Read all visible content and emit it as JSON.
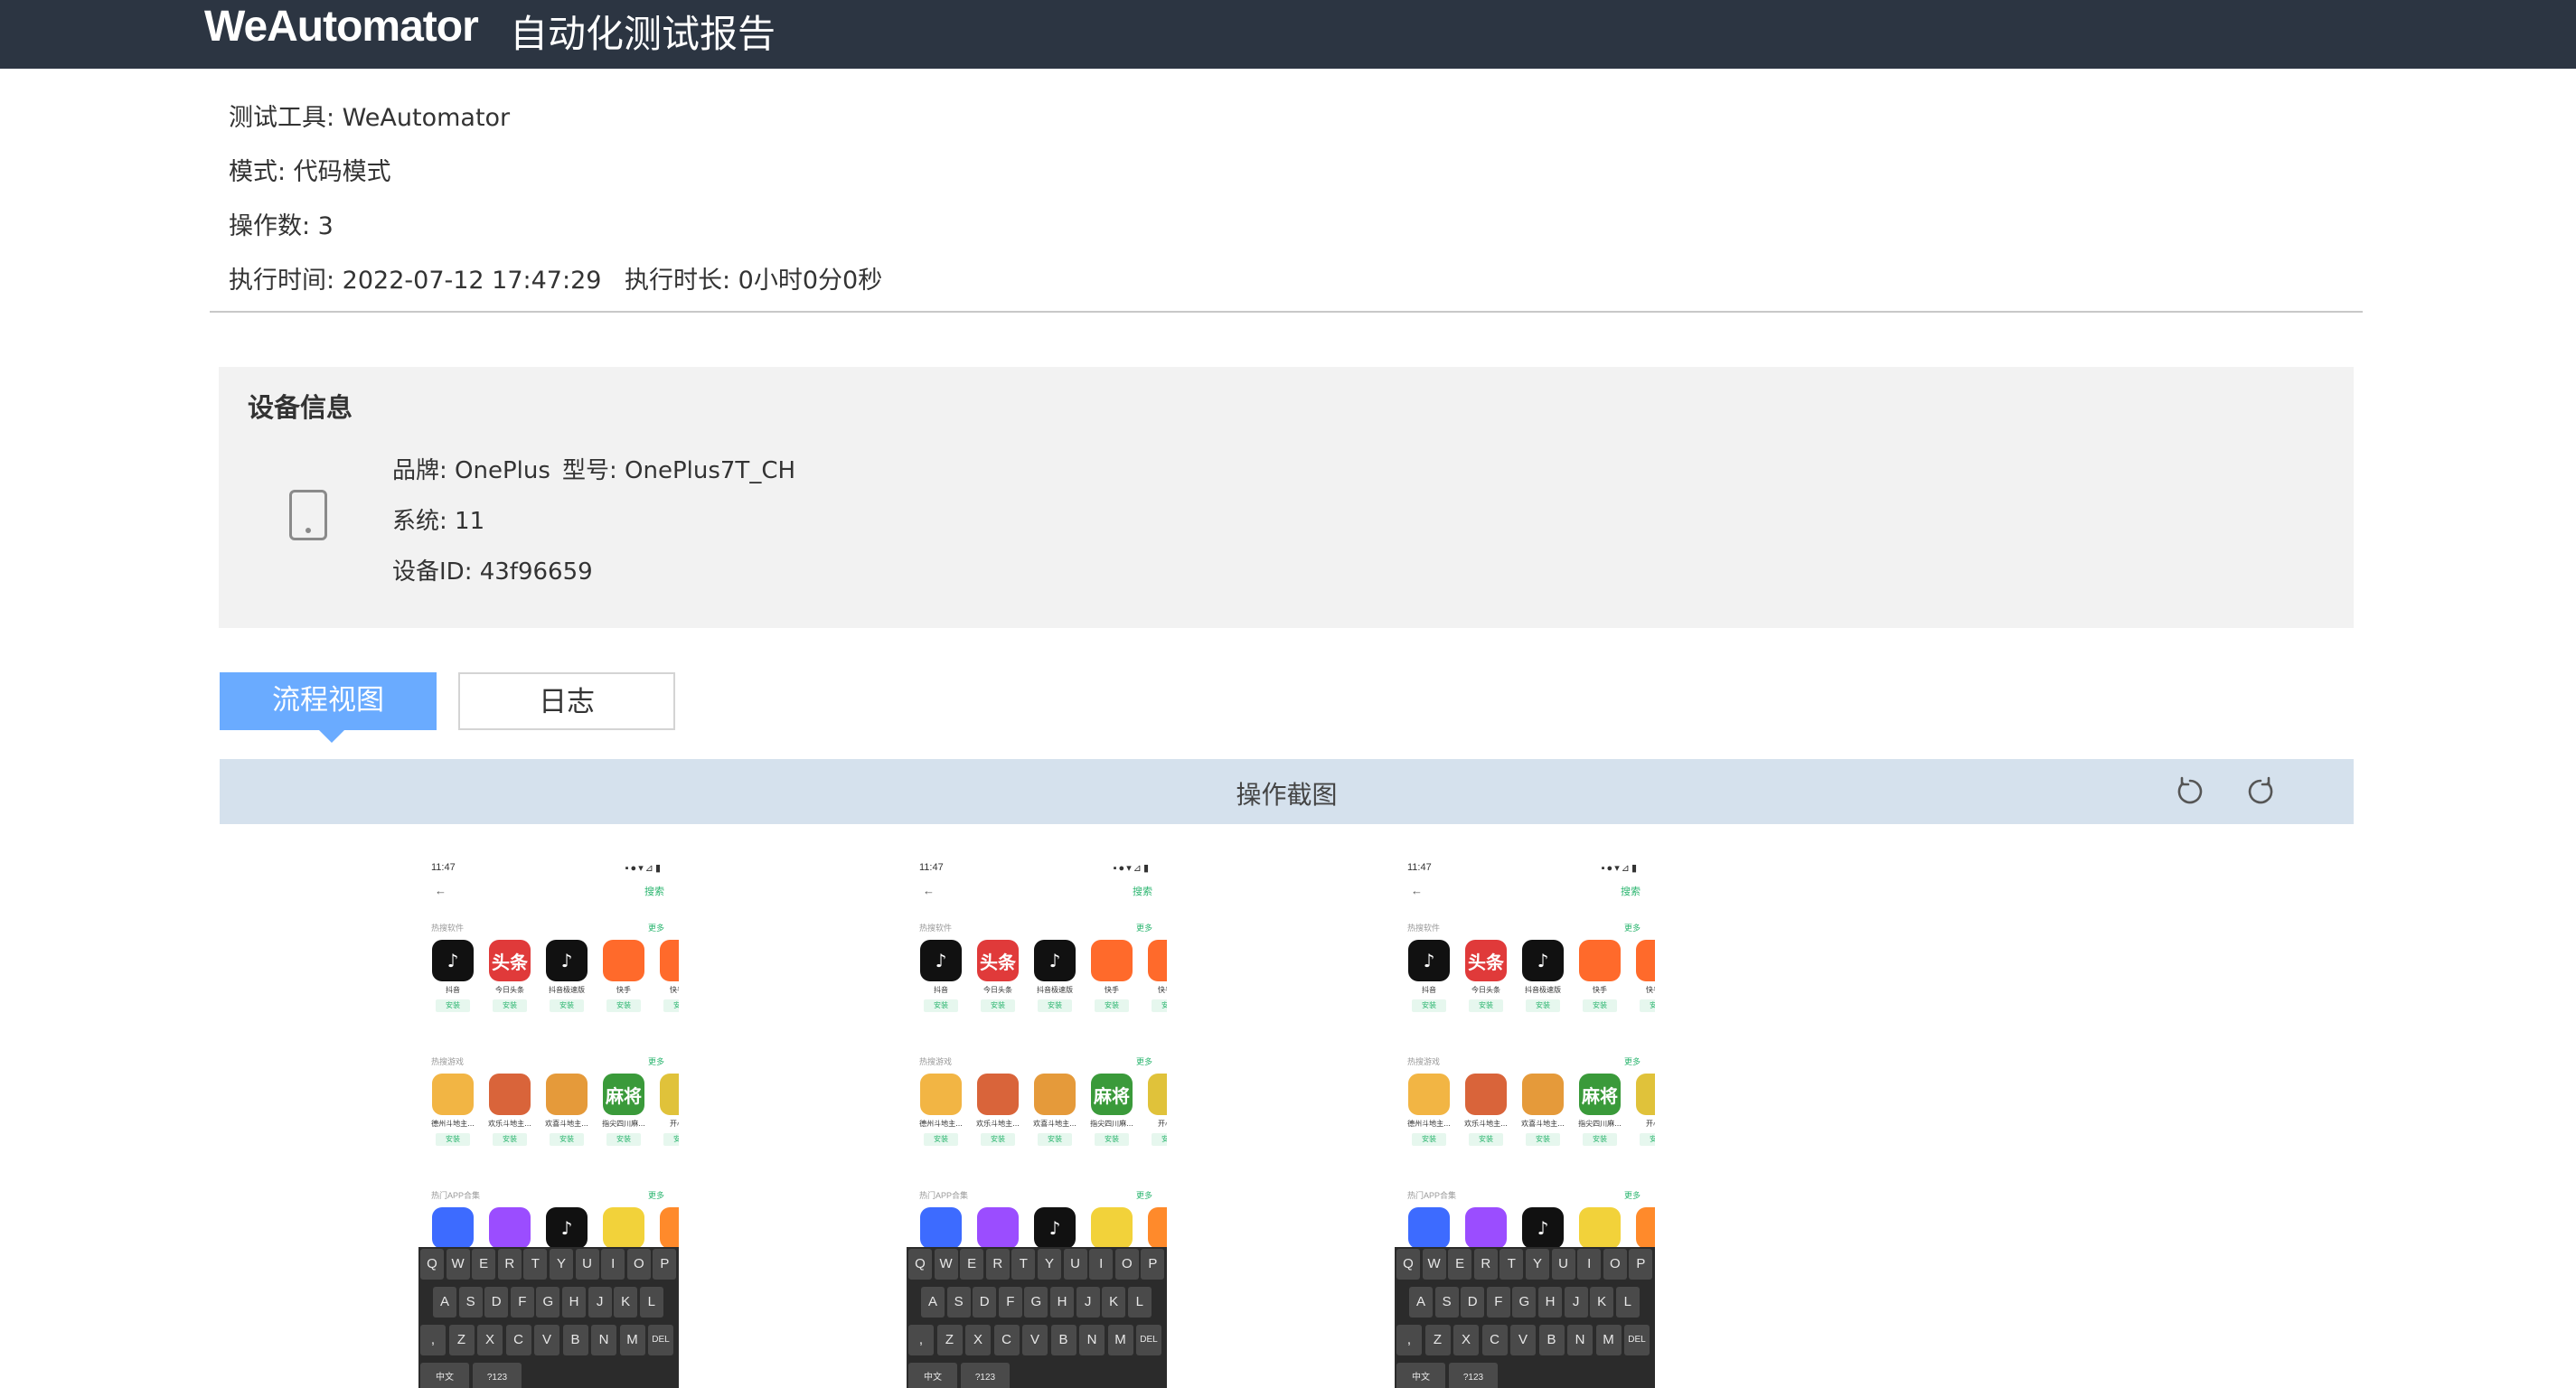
{
  "header": {
    "brand": "WeAutomator",
    "title": "自动化测试报告"
  },
  "summary": {
    "tool": "测试工具: WeAutomator",
    "mode": "模式: 代码模式",
    "ops": "操作数: 3",
    "exec_time": "执行时间: 2022-07-12 17:47:29",
    "duration": "执行时长: 0小时0分0秒"
  },
  "device": {
    "panel_title": "设备信息",
    "brand": "品牌: OnePlus",
    "model": "型号: OnePlus7T_CH",
    "system": "系统: 11",
    "device_id": "设备ID: 43f96659",
    "icon": "tablet-icon"
  },
  "tabs": {
    "flow": "流程视图",
    "log": "日志"
  },
  "screenshots": {
    "bar_label": "操作截图",
    "rotate_left_icon": "rotate-left-icon",
    "rotate_right_icon": "rotate-right-icon"
  },
  "phone": {
    "time": "11:47",
    "search_action": "搜索",
    "sections": [
      "热搜软件",
      "热搜游戏",
      "热门APP合集"
    ],
    "more": "更多",
    "install": "安装",
    "apps": [
      "抖音",
      "今日头条",
      "抖音极速版",
      "快手",
      "快手极"
    ],
    "games": [
      "德州斗地主...",
      "欢乐斗地主...",
      "欢喜斗地主...",
      "指尖四川麻...",
      "开心消"
    ],
    "toutiao_icon_text": "头条",
    "mahjong_icon_text": "麻将",
    "keyboard": {
      "row1": [
        "Q",
        "W",
        "E",
        "R",
        "T",
        "Y",
        "U",
        "I",
        "O",
        "P"
      ],
      "row2": [
        "A",
        "S",
        "D",
        "F",
        "G",
        "H",
        "J",
        "K",
        "L"
      ],
      "row3": [
        ",",
        "Z",
        "X",
        "C",
        "V",
        "B",
        "N",
        "M",
        "DEL"
      ],
      "row4": [
        "中文",
        "?123"
      ]
    }
  },
  "colors": {
    "topbar": "#2c3542",
    "tab_active": "#6aabff",
    "shotbar": "#d5e1ed",
    "install_green": "#2bb56f"
  }
}
